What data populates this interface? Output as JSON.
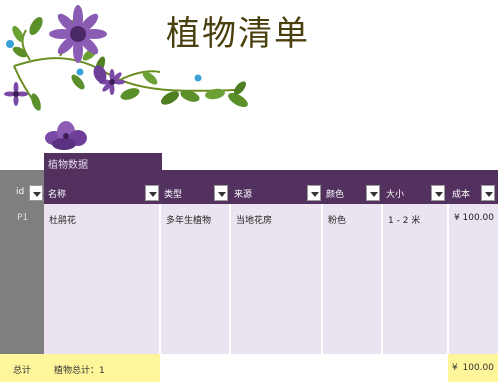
{
  "title": "植物清单",
  "band_label": "植物数据",
  "headers": {
    "id": "id",
    "name": "名称",
    "type": "类型",
    "source": "来源",
    "color": "颜色",
    "size": "大小",
    "cost": "成本"
  },
  "row": {
    "id": "P1",
    "name": "杜鹃花",
    "type": "多年生植物",
    "source": "当地花房",
    "color": "粉色",
    "size": "1 - 2 米",
    "currency": "¥",
    "cost": "100.00"
  },
  "totals": {
    "label": "总计",
    "count_label": "植物总计：1",
    "currency": "¥",
    "cost": "100.00"
  },
  "colors": {
    "header": "#53315f",
    "body": "#ebe4f0",
    "total": "#fff59a",
    "id_column": "#7f7f7f"
  }
}
